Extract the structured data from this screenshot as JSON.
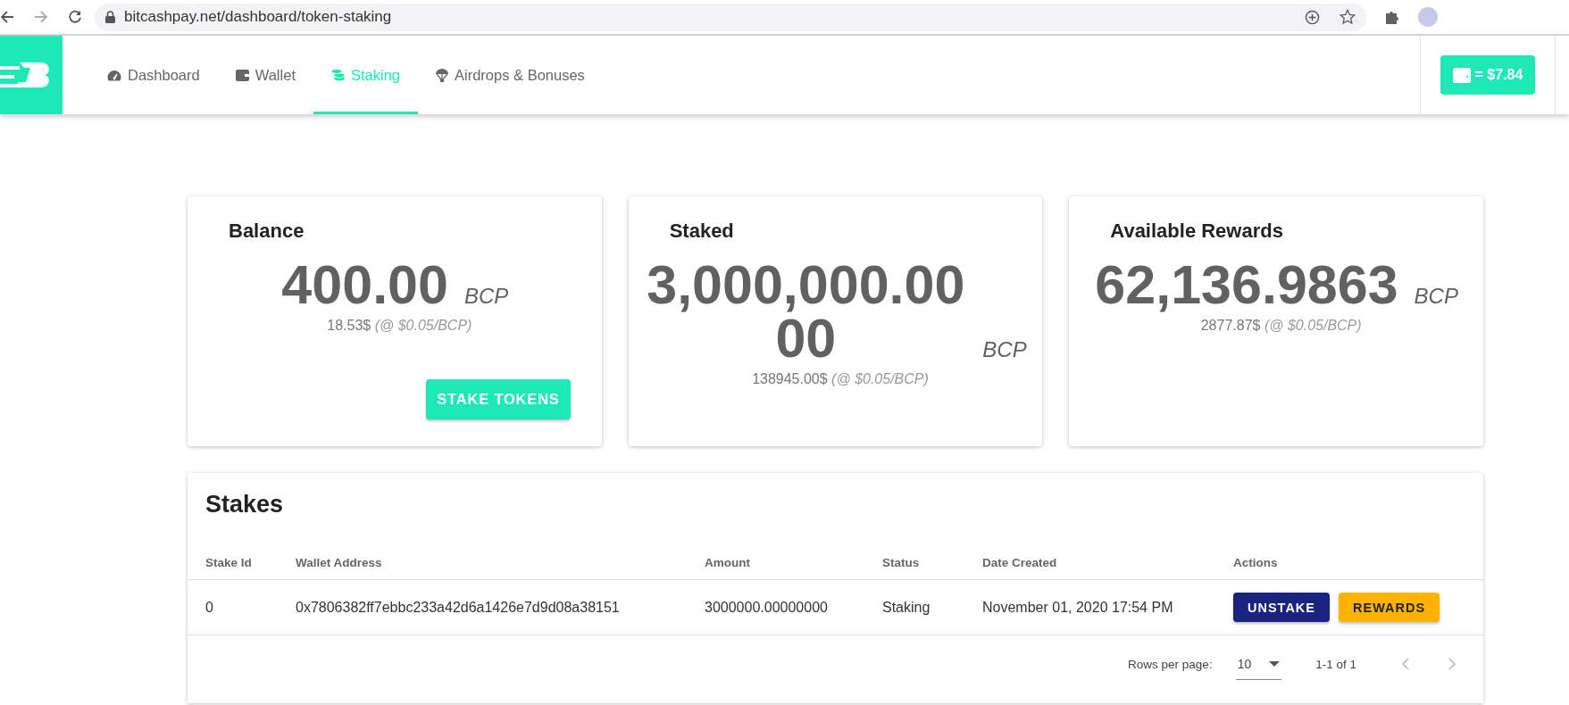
{
  "browser": {
    "url": "bitcashpay.net/dashboard/token-staking"
  },
  "nav": {
    "items": [
      {
        "label": "Dashboard",
        "selected": false
      },
      {
        "label": "Wallet",
        "selected": false
      },
      {
        "label": "Staking",
        "selected": true
      },
      {
        "label": "Airdrops & Bonuses",
        "selected": false
      }
    ],
    "wallet_button": "= $7.84"
  },
  "cards": [
    {
      "title": "Balance",
      "value": "400.00",
      "unit": "BCP",
      "usd": "18.53$",
      "rate": "(@ $0.05/BCP)",
      "button": "STAKE TOKENS"
    },
    {
      "title": "Staked",
      "value": "3,000,000.0000",
      "unit": "BCP",
      "usd": "138945.00$",
      "rate": "(@ $0.05/BCP)"
    },
    {
      "title": "Available Rewards",
      "value": "62,136.9863",
      "unit": "BCP",
      "usd": "2877.87$",
      "rate": "(@ $0.05/BCP)"
    }
  ],
  "stakes": {
    "title": "Stakes",
    "columns": [
      "Stake Id",
      "Wallet Address",
      "Amount",
      "Status",
      "Date Created",
      "Actions"
    ],
    "rows": [
      {
        "cells": [
          "0",
          "0x7806382ff7ebbc233a42d6a1426e7d9d08a38151",
          "3000000.00000000",
          "Staking",
          "November 01, 2020 17:54 PM"
        ],
        "actions": [
          {
            "label": "UNSTAKE",
            "color": "#1a237e"
          },
          {
            "label": "REWARDS",
            "color": "#ffb300"
          }
        ]
      }
    ],
    "footer": {
      "rows_per_page_label": "Rows per page:",
      "rows_per_page": "10",
      "range": "1-1 of 1"
    }
  }
}
